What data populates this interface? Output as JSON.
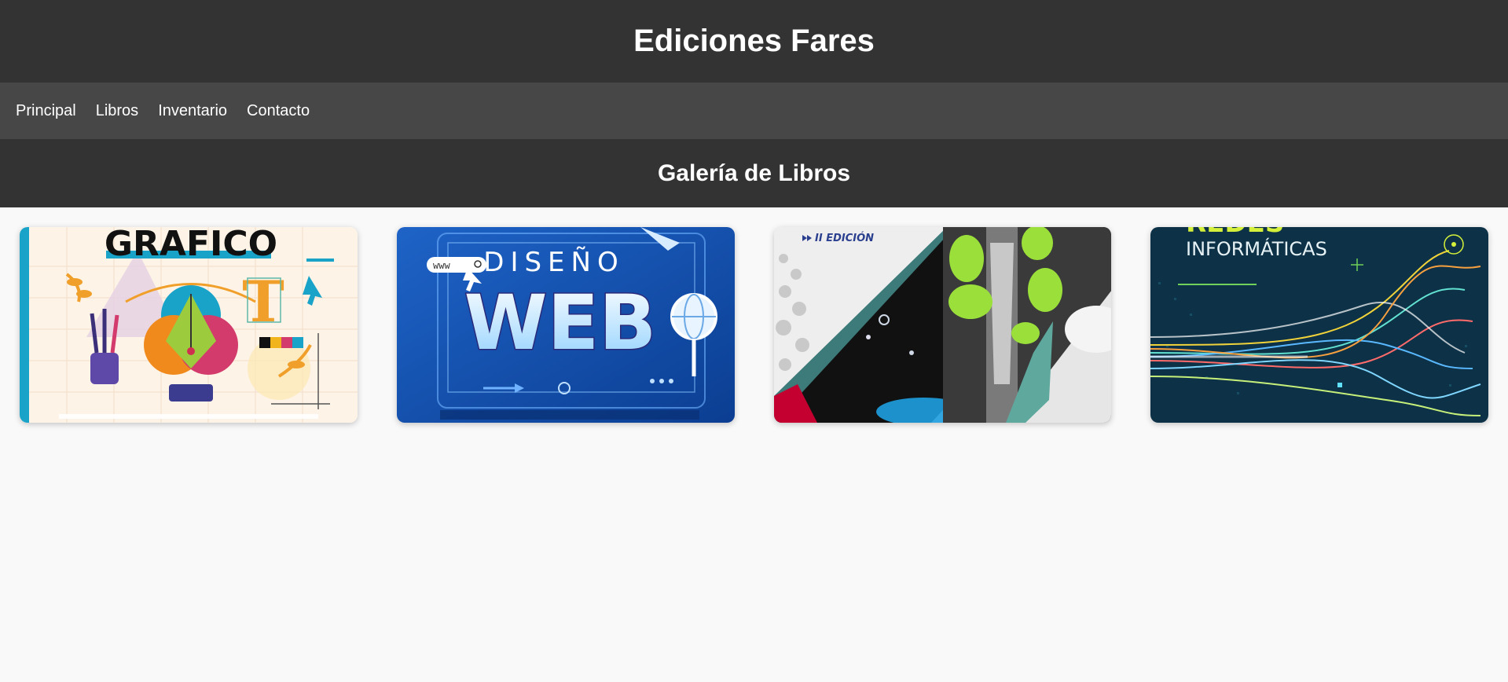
{
  "header": {
    "title": "Ediciones Fares"
  },
  "nav": {
    "items": [
      {
        "label": "Principal"
      },
      {
        "label": "Libros"
      },
      {
        "label": "Inventario"
      },
      {
        "label": "Contacto"
      }
    ]
  },
  "gallery": {
    "title": "Galería de Libros",
    "books": [
      {
        "cover_text": "GRAFICO"
      },
      {
        "cover_text_top": "DISEÑO",
        "cover_text_main": "WEB",
        "url_text": "www"
      },
      {
        "cover_text": "II EDICIÓN"
      },
      {
        "cover_text_top": "REDES",
        "cover_text_main": "INFORMÁTICAS"
      }
    ]
  },
  "colors": {
    "header_bg": "#333333",
    "nav_bg": "#474747",
    "page_bg": "#f9f9f9",
    "text_light": "#ffffff"
  }
}
